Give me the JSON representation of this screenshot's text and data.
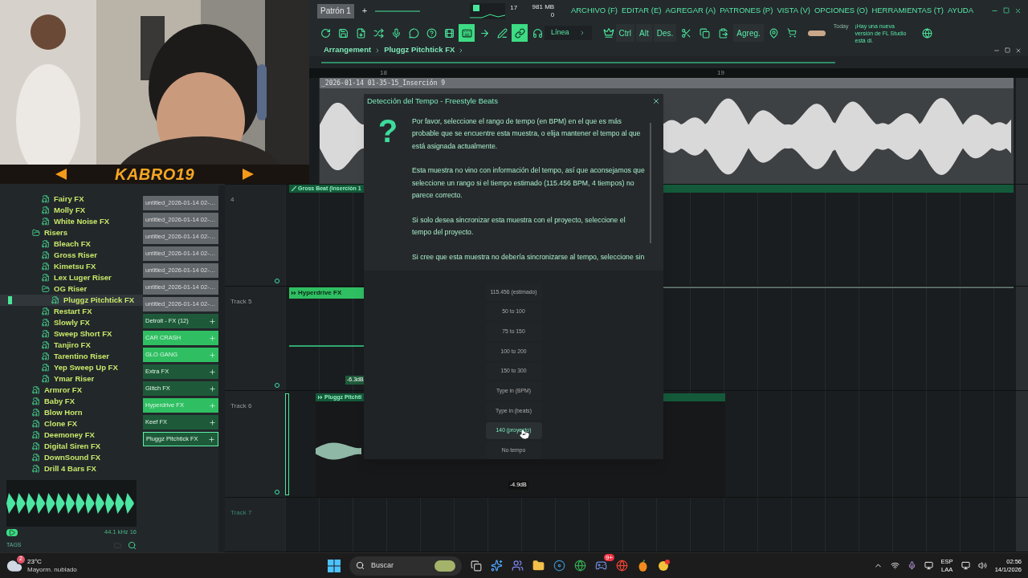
{
  "webcam": {
    "kind": "picture",
    "banner": "KABRO19"
  },
  "top_bar": {
    "pattern": "Patrón 1",
    "add": "+",
    "counter": "17",
    "memory": "981 MB",
    "polyphony": "0",
    "menu": [
      "ARCHIVO (F)",
      "EDITAR (E)",
      "AGREGAR (A)",
      "PATRONES (P)",
      "VISTA (V)",
      "OPCIONES (O)",
      "HERRAMIENTAS (T)",
      "AYUDA"
    ]
  },
  "toolbar": {
    "tools": [
      {
        "active": false
      },
      {
        "active": false
      },
      {
        "active": false
      },
      {
        "active": false
      },
      {
        "active": false
      },
      {
        "active": false
      },
      {
        "active": false
      },
      {
        "active": false
      },
      {
        "active": true
      },
      {
        "active": false
      },
      {
        "active": false
      },
      {
        "active": true
      }
    ],
    "snap": "Línea",
    "keys": [
      "Ctrl",
      "Alt",
      "Des."
    ],
    "add": "Agreg.",
    "news_day": "Today",
    "news": "¡Hay una nueva versión de FL Studio está di."
  },
  "browser": {
    "tree": [
      {
        "kind": "group",
        "children": [
          {
            "kind": "file",
            "label": "Fairy FX",
            "selected": false
          },
          {
            "kind": "file",
            "label": "Molly FX",
            "selected": false
          },
          {
            "kind": "file",
            "label": "White Noise FX",
            "selected": false
          }
        ]
      },
      {
        "kind": "folder",
        "label": "Risers",
        "expanded": true,
        "selected": false,
        "children": [
          {
            "kind": "file",
            "label": "Bleach FX",
            "selected": false
          },
          {
            "kind": "file",
            "label": "Gross Riser",
            "selected": false
          },
          {
            "kind": "file",
            "label": "Kimetsu FX",
            "selected": false
          },
          {
            "kind": "file",
            "label": "Lex Luger Riser",
            "selected": false
          },
          {
            "kind": "folder",
            "label": "OG Riser",
            "expanded": true,
            "selected": false,
            "children": [
              {
                "kind": "file",
                "label": "Pluggz Pitchtick FX",
                "selected": true
              }
            ]
          },
          {
            "kind": "file",
            "label": "Restart FX",
            "selected": false
          },
          {
            "kind": "file",
            "label": "Slowly FX",
            "selected": false
          },
          {
            "kind": "file",
            "label": "Sweep Short FX",
            "selected": false
          },
          {
            "kind": "file",
            "label": "Tanjiro FX",
            "selected": false
          },
          {
            "kind": "file",
            "label": "Tarentino Riser",
            "selected": false
          },
          {
            "kind": "file",
            "label": "Yep Sweep Up FX",
            "selected": false
          },
          {
            "kind": "file",
            "label": "Ymar Riser",
            "selected": false
          }
        ]
      },
      {
        "kind": "file",
        "label": "Armror FX",
        "selected": false
      },
      {
        "kind": "file",
        "label": "Baby FX",
        "selected": false
      },
      {
        "kind": "file",
        "label": "Blow Horn",
        "selected": false
      },
      {
        "kind": "file",
        "label": "Clone FX",
        "selected": false
      },
      {
        "kind": "file",
        "label": "Deemoney FX",
        "selected": false
      },
      {
        "kind": "file",
        "label": "Digital Siren FX",
        "selected": false
      },
      {
        "kind": "file",
        "label": "DownSound FX",
        "selected": false
      },
      {
        "kind": "file",
        "label": "Drill 4 Bars FX",
        "selected": false
      }
    ],
    "sample_info": "44.1 kHz 16",
    "tags": "TAGS"
  },
  "clips": [
    {
      "kind": "audio",
      "label": "untitled_2026-01-14 02-…",
      "selected": false
    },
    {
      "kind": "audio",
      "label": "untitled_2026-01-14 02-…",
      "selected": false
    },
    {
      "kind": "audio",
      "label": "untitled_2026-01-14 02-…",
      "selected": false
    },
    {
      "kind": "audio",
      "label": "untitled_2026-01-14 02-…",
      "selected": false
    },
    {
      "kind": "audio",
      "label": "untitled_2026-01-14 02-…",
      "selected": false
    },
    {
      "kind": "audio",
      "label": "untitled_2026-01-14 02-…",
      "selected": false
    },
    {
      "kind": "audio",
      "label": "untitled_2026-01-14 02-…",
      "selected": false
    },
    {
      "kind": "pattern",
      "label": "Detroit - FX (12)",
      "color": "#1e5a3a",
      "selected": false
    },
    {
      "kind": "pattern",
      "label": "CAR CRASH",
      "color": "#2fbf62",
      "selected": false
    },
    {
      "kind": "pattern",
      "label": "GLO GANG",
      "color": "#2fbf62",
      "selected": false
    },
    {
      "kind": "pattern",
      "label": "Extra FX",
      "color": "#1e5a3a",
      "selected": false
    },
    {
      "kind": "pattern",
      "label": "Glitch FX",
      "color": "#1e5a3a",
      "selected": false
    },
    {
      "kind": "pattern",
      "label": "Hyperdrive FX",
      "color": "#2fbf62",
      "selected": false
    },
    {
      "kind": "pattern",
      "label": "Keef FX",
      "color": "#1e5a3a",
      "selected": false
    },
    {
      "kind": "pattern",
      "label": "Pluggz Pitchtick FX",
      "color": "#1e5a3a",
      "selected": true
    }
  ],
  "playlist": {
    "breadcrumb": [
      "Arrangement",
      "Pluggz Pitchtick FX"
    ],
    "ruler": [
      "18",
      "19"
    ],
    "tracks": [
      {
        "clip": {
          "kind": "audio",
          "label": "_2026-01-14 01-35-15_Inserción 9"
        }
      },
      {
        "name": "4",
        "clip": {
          "kind": "automation",
          "label": "Gross Beat (Inserción 1"
        }
      },
      {
        "name": "Track 5",
        "clip": {
          "kind": "pattern",
          "label": "Hyperdrive FX"
        },
        "volume": "-6.3dB"
      },
      {
        "name": "Track 6",
        "clip": {
          "kind": "audio",
          "label": "Pluggz Pitchti"
        },
        "volume": "-4.9dB"
      },
      {
        "name": "Track 7",
        "empty": true
      }
    ]
  },
  "dialog": {
    "title": "Detección del Tempo - Freestyle Beats",
    "icon": "?",
    "paragraphs": [
      "Por favor, seleccione el rango de tempo (en BPM) en el que es más probable que se encuentre esta muestra, o elija mantener el tempo al que está asignada actualmente.",
      "Esta muestra no vino con información del tempo, así que aconsejamos que seleccione un rango si el tiempo estimado (115.456 BPM, 4 tiempos) no parece correcto.",
      "Si solo desea sincronizar esta muestra con el proyecto, seleccione el tempo del proyecto.",
      "Si cree que esta muestra no debería sincronizarse al tempo, seleccione sin"
    ],
    "options": [
      {
        "label": "115.456 (estimado)",
        "selected": false
      },
      {
        "label": "50 to 100",
        "selected": false
      },
      {
        "label": "75 to 150",
        "selected": false
      },
      {
        "label": "100 to 200",
        "selected": false
      },
      {
        "label": "150 to 300",
        "selected": false
      },
      {
        "label": "Type in (BPM)",
        "selected": false
      },
      {
        "label": "Type in (beats)",
        "selected": false
      },
      {
        "label": "140 (proyecto)",
        "selected": true
      },
      {
        "label": "No tempo",
        "selected": false
      }
    ]
  },
  "taskbar": {
    "temperature": "23°C",
    "weather": "Mayorm. nublado",
    "weather_badge": "2",
    "search_placeholder": "Buscar",
    "chat_badge": "9+",
    "lang": "ESP",
    "region": "LAA",
    "time": "02:56",
    "date": "14/1/2026"
  }
}
